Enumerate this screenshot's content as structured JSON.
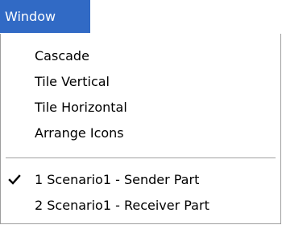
{
  "menu": {
    "title": "Window",
    "items": [
      {
        "label": "Cascade"
      },
      {
        "label": "Tile Vertical"
      },
      {
        "label": "Tile Horizontal"
      },
      {
        "label": "Arrange Icons"
      }
    ],
    "windows": [
      {
        "label": "1 Scenario1 - Sender Part",
        "checked": true
      },
      {
        "label": "2 Scenario1 - Receiver Part",
        "checked": false
      }
    ]
  },
  "colors": {
    "highlight": "#316ac5",
    "border": "#9d9d9d",
    "separator": "#a0a0a0"
  },
  "icons": {
    "checkmark": "checkmark-icon"
  }
}
